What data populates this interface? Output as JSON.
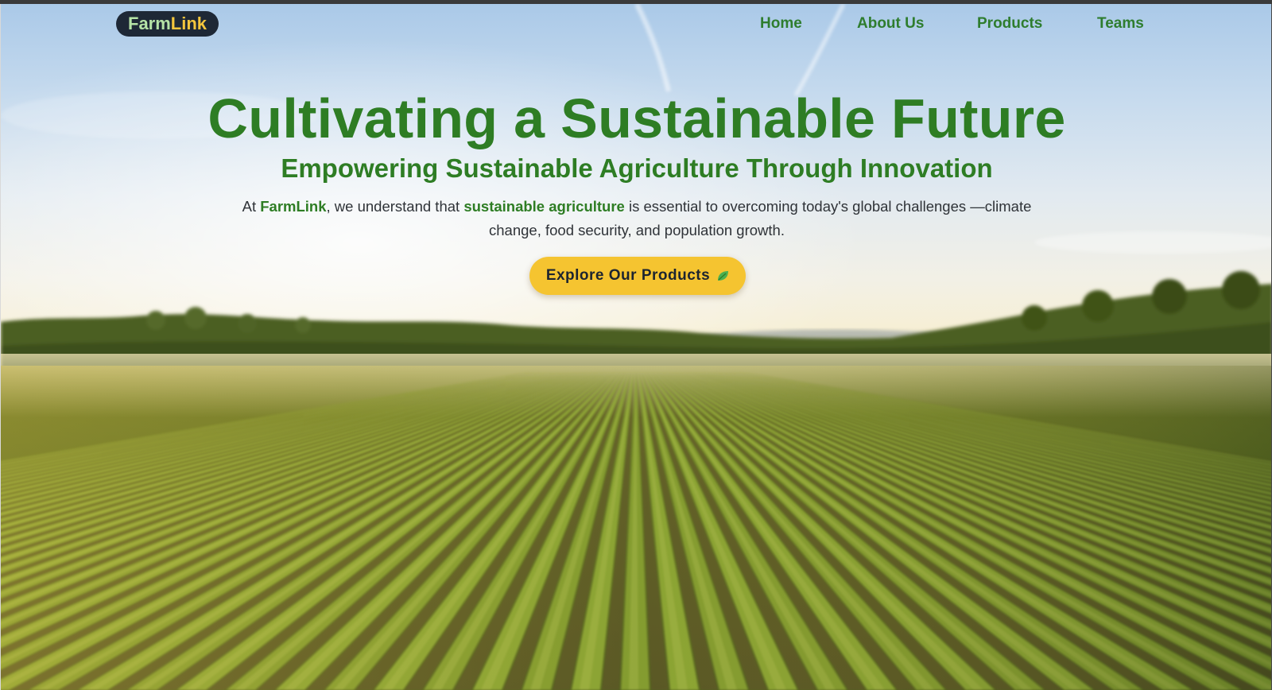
{
  "brand": {
    "part1": "Farm",
    "part2": "Link"
  },
  "nav": {
    "items": [
      {
        "label": "Home"
      },
      {
        "label": "About Us"
      },
      {
        "label": "Products"
      },
      {
        "label": "Teams"
      }
    ]
  },
  "hero": {
    "title": "Cultivating a Sustainable Future",
    "subtitle": "Empowering Sustainable Agriculture Through Innovation",
    "text": {
      "t1": "At ",
      "brand": "FarmLink",
      "t2": ", we understand that ",
      "emphasis": "sustainable agriculture",
      "t3": " is essential to overcoming today's global challenges —climate change, food security, and population growth."
    },
    "cta_label": "Explore Our Products",
    "cta_icon": "leaf-icon"
  },
  "colors": {
    "brand_green": "#2e7d24",
    "accent_yellow": "#f5c430",
    "logo_bg": "#1e2836"
  }
}
